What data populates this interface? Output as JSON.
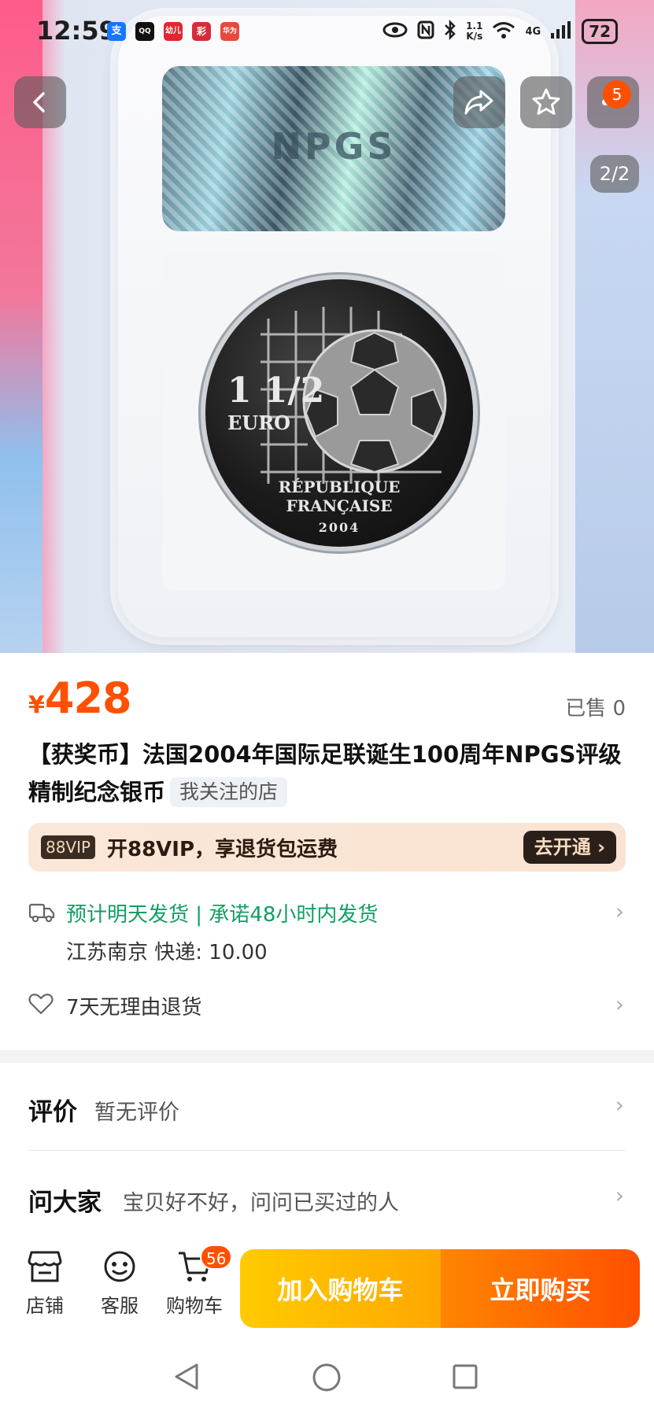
{
  "status_bar": {
    "time": "12:59",
    "apps": [
      "支",
      "QQ",
      "幼儿",
      "彩",
      "华为"
    ],
    "speed_value": "1.1",
    "speed_unit": "K/s",
    "network": "4G",
    "battery": "72"
  },
  "hero": {
    "holo_text": "NPGS",
    "coin_denomination": "1 1/2",
    "coin_currency": "EURO",
    "coin_line1": "RÉPUBLIQUE",
    "coin_line2": "FRANÇAISE",
    "coin_year": "2004",
    "pager": "2/2",
    "favorite_badge": "5"
  },
  "product": {
    "currency_symbol": "¥",
    "price": "428",
    "sold": "已售 0",
    "title": "【获奖币】法国2004年国际足联诞生100周年NPGS评级精制纪念银币",
    "shop_tag": "我关注的店"
  },
  "vip": {
    "badge": "88VIP",
    "text": "开88VIP，享退货包运费",
    "button": "去开通"
  },
  "shipping": {
    "promise": "预计明天发货 | 承诺48小时内发货",
    "detail": "江苏南京  快递: 10.00"
  },
  "returns": {
    "text": "7天无理由退货"
  },
  "reviews": {
    "heading": "评价",
    "sub": "暂无评价"
  },
  "ask": {
    "heading": "问大家",
    "sub": "宝贝好不好，问问已买过的人"
  },
  "bottom_bar": {
    "shop": "店铺",
    "service": "客服",
    "cart": "购物车",
    "cart_count": "56",
    "add_to_cart": "加入购物车",
    "buy_now": "立即购买"
  },
  "colors": {
    "accent": "#ff5000",
    "green": "#129e62",
    "cta_yellow": "#ffb400"
  }
}
